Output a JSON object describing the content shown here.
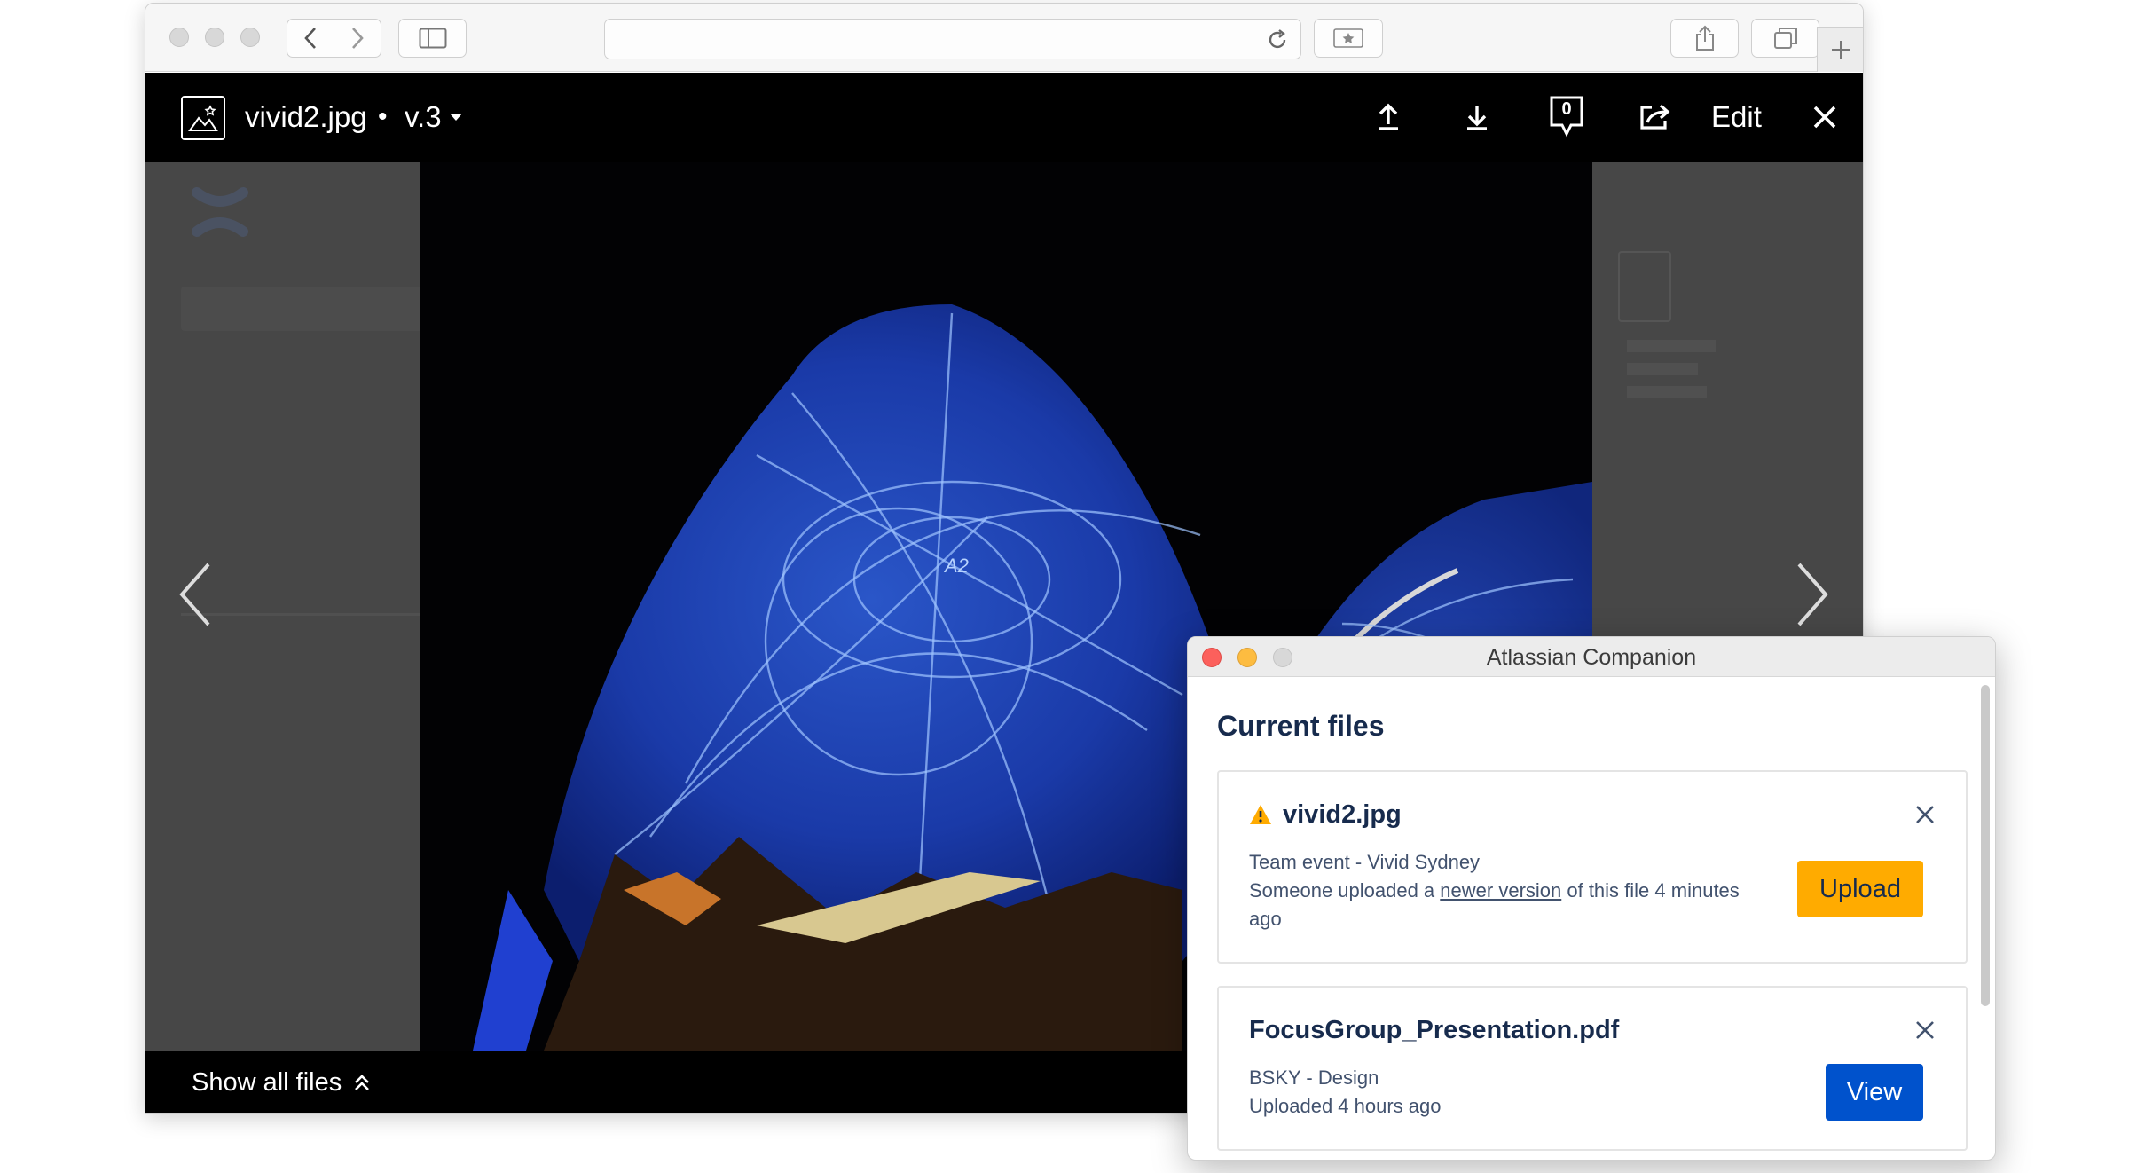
{
  "viewer": {
    "file_name": "vivid2.jpg",
    "dot": "•",
    "version": "v.3",
    "comment_count": "0",
    "edit_label": "Edit",
    "show_all_label": "Show all files"
  },
  "companion": {
    "window_title": "Atlassian Companion",
    "heading": "Current files",
    "files": [
      {
        "name": "vivid2.jpg",
        "line1": "Team event - Vivid Sydney",
        "line2_before": "Someone uploaded a ",
        "line2_link": "newer version",
        "line2_after": " of this file 4 minutes ago",
        "action": "Upload"
      },
      {
        "name": "FocusGroup_Presentation.pdf",
        "line1": "BSKY - Design",
        "line2": "Uploaded 4 hours ago",
        "action": "View"
      }
    ]
  },
  "colors": {
    "upload_button": "#ffab00",
    "view_button": "#0052cc",
    "warning_icon": "#ffab00",
    "heading_text": "#172b4d",
    "body_text": "#42526e"
  },
  "icons": {
    "toolbar": [
      "back-icon",
      "forward-icon",
      "sidebar-icon",
      "reload-icon",
      "bookmark-icon",
      "share-icon",
      "tabs-icon",
      "new-tab-icon"
    ],
    "viewer": [
      "image-file-icon",
      "caret-down-icon",
      "upload-icon",
      "download-icon",
      "comment-icon",
      "share-icon",
      "close-icon",
      "prev-arrow-icon",
      "next-arrow-icon",
      "chevron-up-double-icon"
    ],
    "companion": [
      "warning-icon",
      "close-icon"
    ]
  }
}
